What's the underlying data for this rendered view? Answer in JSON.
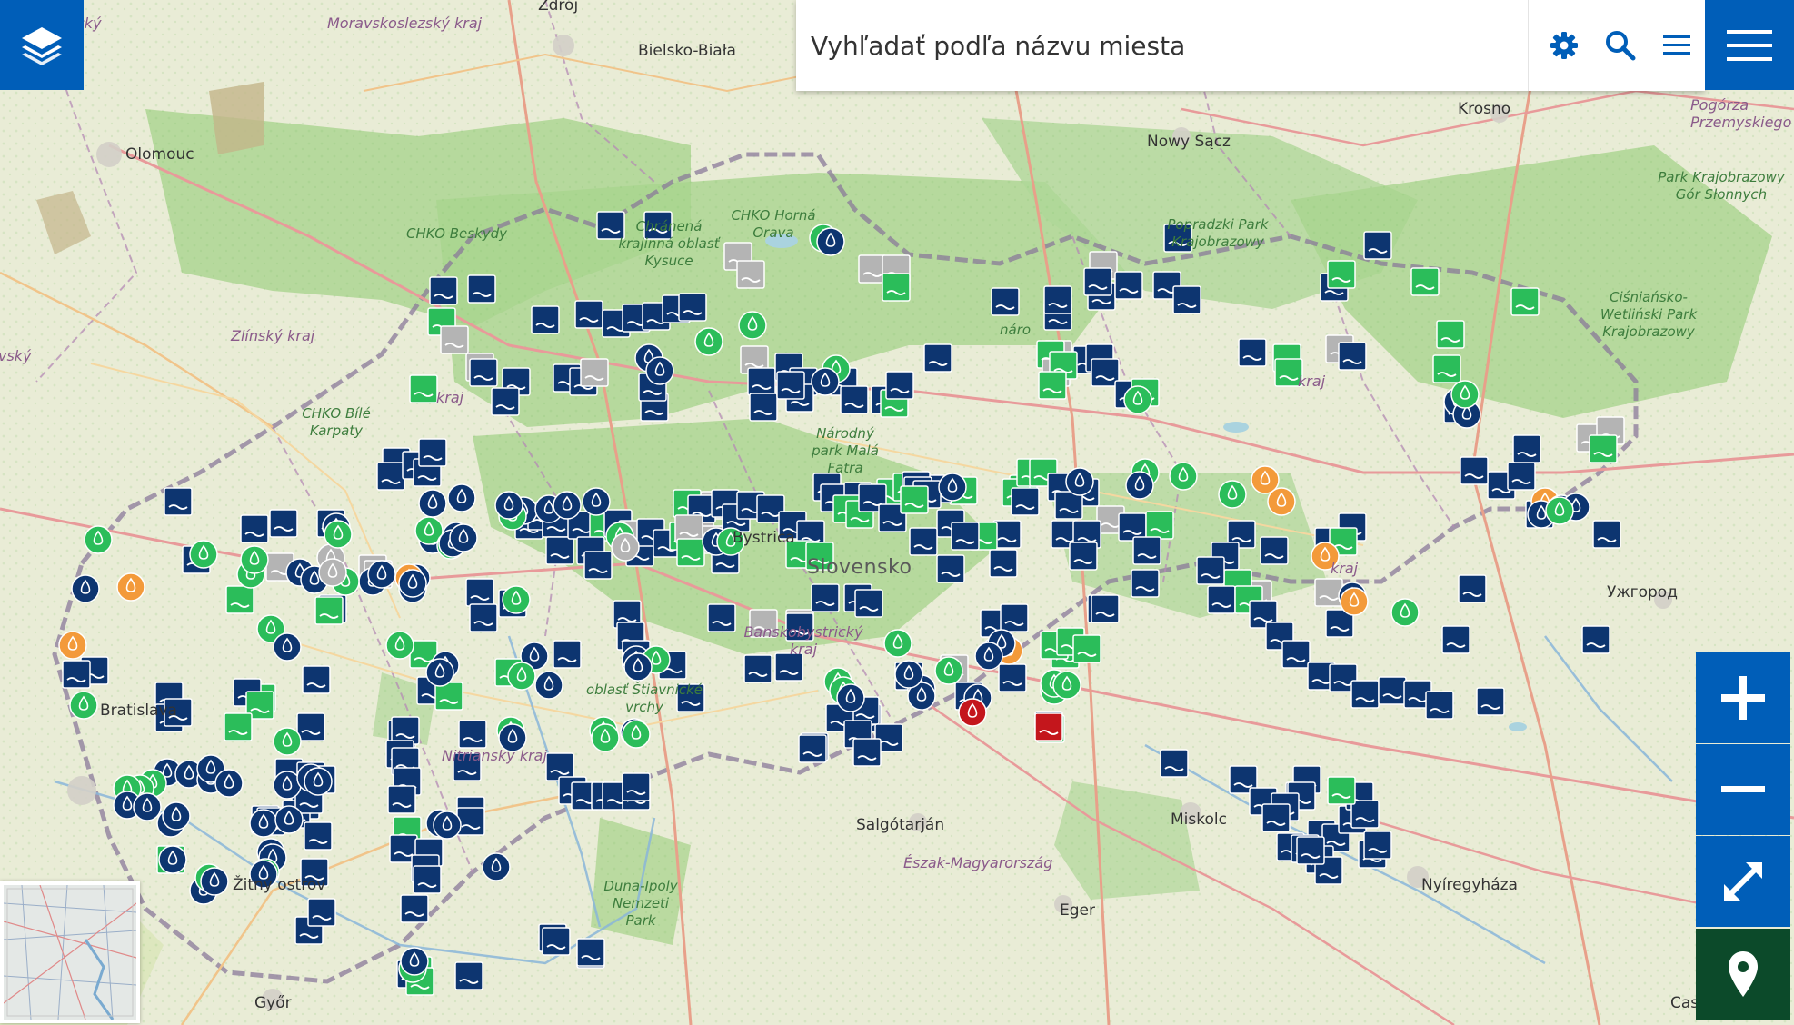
{
  "search": {
    "placeholder": "Vyhľadať podľa názvu miesta"
  },
  "icons": {
    "layers": "layers-icon",
    "settings": "gear-icon",
    "search": "search-icon",
    "list": "list-icon",
    "menu": "hamburger-menu-icon",
    "zoom_in": "plus-icon",
    "zoom_out": "minus-icon",
    "fullscreen": "expand-icon",
    "locate": "location-pin-icon"
  },
  "colors": {
    "brand_blue": "#005eb8",
    "marker_navy": "#0d3570",
    "marker_green": "#2bbd5a",
    "marker_gray": "#b4b4b4",
    "marker_orange": "#f39a3a",
    "marker_red": "#c4161c",
    "location_green": "#0c4a2a"
  },
  "labels": {
    "country": "Slovensko",
    "cities": [
      "Bielsko-Biała",
      "Nowy Sącz",
      "Krosno",
      "Olomouc",
      "Ужгород",
      "Salgótarján",
      "Miskolc",
      "Eger",
      "Nyíregyháza",
      "Győr",
      "Zdrój",
      "Bystrica",
      "Žitný ostrov",
      "Bratislava",
      "Cas"
    ],
    "regions": [
      "Moravskoslezský kraj",
      "Zlínský kraj",
      "Nitriansky kraj",
      "Banskobystrický kraj",
      "Észak-Magyarország",
      "Pogórza Przemyskiego",
      "vský",
      "cký",
      "kraj",
      "kraj",
      "kraj"
    ],
    "parks": [
      "CHKO Beskydy",
      "CHKO Horná Orava",
      "Chránená krajinná oblasť Kysuce",
      "CHKO Bílé Karpaty",
      "Popradzki Park Krajobrazowy",
      "Park Krajobrazowy Gór Słonnych",
      "Ciśniańsko-Wetliński Park Krajobrazowy",
      "Národný park Malá Fatra",
      "Duna-Ipoly Nemzeti Park",
      "oblasť Štiavnické vrchy",
      "náro"
    ]
  }
}
